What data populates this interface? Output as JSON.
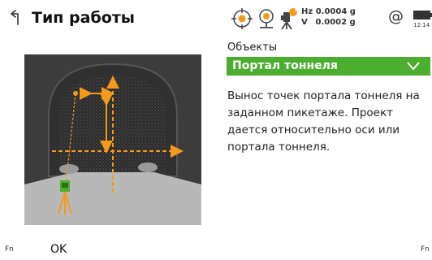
{
  "header": {
    "title": "Тип работы",
    "hz_label": "Hz",
    "hz_value": "0.0004 g",
    "v_label": "V",
    "v_value": "0.0002 g",
    "at_symbol": "@",
    "battery_time": "12:14",
    "icons": [
      "back-icon",
      "target-crosshair-icon",
      "prism-icon",
      "instrument-status-icon",
      "battery-icon"
    ],
    "warning_badge": "!"
  },
  "main": {
    "objects_label": "Объекты",
    "objects_value": "Портал тоннеля",
    "description": "Вынос точек портала тоннеля на заданном пикетаже. Проект дается относительно оси или портала тоннеля."
  },
  "footer": {
    "fn_left": "Fn",
    "ok_label": "OK",
    "fn_right": "Fn"
  },
  "colors": {
    "accent_green": "#4cae2f",
    "arrow_orange": "#f29a1c",
    "tunnel_dark": "#3c3c3c",
    "floor_gray": "#b8b8b8"
  }
}
